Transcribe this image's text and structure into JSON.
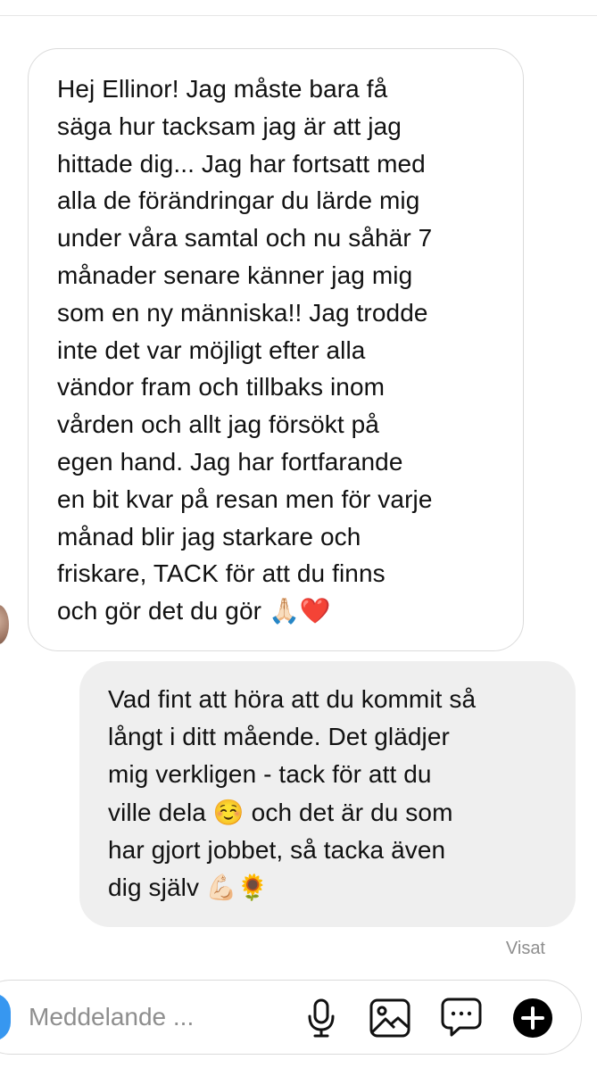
{
  "thread": {
    "incoming_message": "Hej Ellinor! Jag måste bara få\nsäga hur tacksam jag är att jag\nhittade dig... Jag har fortsatt med\nalla de förändringar du lärde mig\nunder våra samtal och nu såhär 7\nmånader senare känner jag mig\nsom en ny människa!! Jag trodde\ninte det var möjligt efter alla\nvändor fram och tillbaks inom\nvården och allt jag försökt på\negen hand. Jag har fortfarande\nen bit kvar på resan men för varje\nmånad blir jag starkare och\nfriskare, TACK för att du finns\noch gör det du gör 🙏🏻❤️",
    "outgoing_message": "Vad fint att höra att du kommit så\nlångt i ditt mående. Det glädjer\nmig verkligen - tack för att du\nville dela ☺️ och det är du som\nhar gjort jobbet, så tacka även\ndig själv 💪🏻🌻",
    "seen_label": "Visat"
  },
  "composer": {
    "placeholder": "Meddelande ...",
    "value": "",
    "icons": [
      "camera-icon",
      "microphone-icon",
      "gallery-icon",
      "sticker-icon",
      "plus-icon"
    ]
  },
  "colors": {
    "incoming_bubble_bg": "#ffffff",
    "incoming_bubble_border": "#dbdbdb",
    "outgoing_bubble_bg": "#efefef",
    "meta_text": "#8e8e8e",
    "accent_blue": "#3797f0"
  }
}
